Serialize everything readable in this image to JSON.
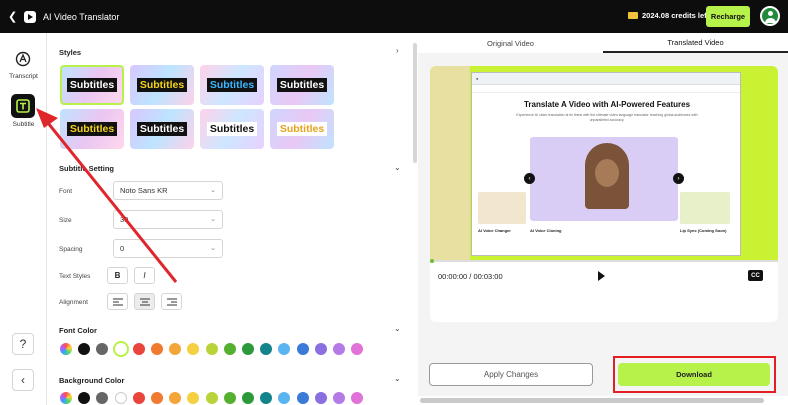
{
  "topbar": {
    "back_icon": "chevron-left-icon",
    "title": "AI Video Translator",
    "credits": "2024.08 credits left",
    "recharge_label": "Recharge"
  },
  "leftnav": {
    "items": [
      {
        "label": "Transcript",
        "icon": "transcript-icon"
      },
      {
        "label": "Subtitle",
        "icon": "subtitle-icon"
      }
    ],
    "help": "?",
    "collapse": "‹"
  },
  "styles": {
    "title": "Styles",
    "tiles": [
      {
        "text": "Subtitles",
        "fg": "#ffffff",
        "box": "#111111",
        "selected": true
      },
      {
        "text": "Subtitles",
        "fg": "#f5d31a",
        "box": "#111111"
      },
      {
        "text": "Subtitles",
        "fg": "#3ab7ff",
        "box": "#111111"
      },
      {
        "text": "Subtitles",
        "fg": "#ffffff",
        "box": "#111111"
      },
      {
        "text": "Subtitles",
        "fg": "#f5d31a",
        "box": "#111111"
      },
      {
        "text": "Subtitles",
        "fg": "#ffffff",
        "box": "#111111"
      },
      {
        "text": "Subtitles",
        "fg": "#111111",
        "box": "#ffffff"
      },
      {
        "text": "Subtitles",
        "fg": "#e8a21e",
        "box": "#ffffff"
      }
    ]
  },
  "subtitle_setting": {
    "title": "Subtitle Setting",
    "font_label": "Font",
    "font_value": "Noto Sans KR",
    "size_label": "Size",
    "size_value": "30",
    "spacing_label": "Spacing",
    "spacing_value": "0",
    "text_styles_label": "Text Styles",
    "bold": "B",
    "italic": "I",
    "alignment_label": "Alignment"
  },
  "font_color": {
    "title": "Font Color",
    "colors": [
      "#ffffff",
      "#111111",
      "#666666",
      "#ffffff",
      "#e8463c",
      "#f07a2e",
      "#f4a53a",
      "#f5d040",
      "#b9d43a",
      "#56b030",
      "#2c9a3a",
      "#13848c",
      "#5ab4f0",
      "#3a7ad8",
      "#8a6fe0",
      "#b47ae6",
      "#e072d8"
    ]
  },
  "background_color": {
    "title": "Background Color"
  },
  "video": {
    "tab_original": "Original Video",
    "tab_translated": "Translated Video",
    "page_heading": "Translate A Video with AI-Powered Features",
    "page_sub": "Experience AI video translation at its finest with the ultimate video language translator reaching global audiences with unparalleled accuracy.",
    "feature1": "AI Voice Changer",
    "feature2": "AI Voice Cloning",
    "feature3": "Lip Sync (Coming Soon)",
    "time": "00:00:00 / 00:03:00",
    "cc": "CC"
  },
  "actions": {
    "apply_label": "Apply Changes",
    "download_label": "Download"
  }
}
